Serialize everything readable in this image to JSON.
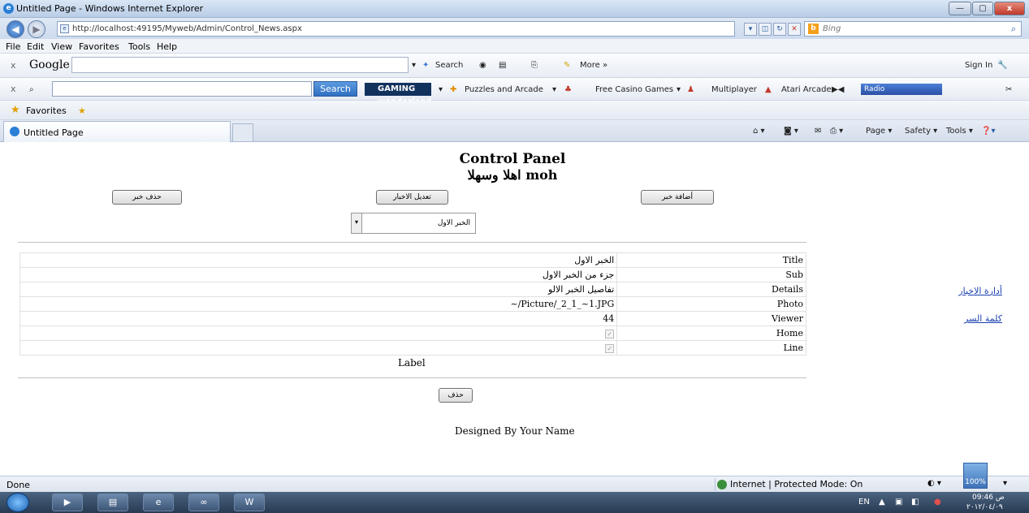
{
  "window": {
    "title": "Untitled Page - Windows Internet Explorer",
    "min_label": "—",
    "max_label": "▢",
    "close_label": "x"
  },
  "address": {
    "url": "http://localhost:49195/Myweb/Admin/Control_News.aspx",
    "search_placeholder": "Bing"
  },
  "menu": [
    "File",
    "Edit",
    "View",
    "Favorites",
    "Tools",
    "Help"
  ],
  "google_toolbar": {
    "close": "x",
    "logo": "Google",
    "search_label": "Search",
    "more_label": "More »",
    "signin_label": "Sign In"
  },
  "toolbar2": {
    "close": "x",
    "search_button": "Search",
    "gaming": "GAMING wonderland",
    "puzzles": "Puzzles and Arcade",
    "casino": "Free Casino Games",
    "multiplayer": "Multiplayer",
    "atari": "Atari Arcade",
    "radio": "Radio"
  },
  "favorites": {
    "label": "Favorites"
  },
  "tabs": {
    "active": "Untitled Page",
    "commands": [
      "Page ▾",
      "Safety ▾",
      "Tools ▾"
    ]
  },
  "page": {
    "title": "Control Panel",
    "welcome": "اهلا وسهلا moh",
    "buttons": {
      "delete_news": "حذف خبر",
      "edit_news": "تعديل الاخبار",
      "add_news": "أضافة خبر",
      "delete": "حذف"
    },
    "dropdown_value": "الخبر الاول",
    "details": [
      {
        "key": "Title",
        "value": "الخبر الاول"
      },
      {
        "key": "Sub",
        "value": "جزء من الخبر الاول"
      },
      {
        "key": "Details",
        "value": "تفاصيل الخبر الالو"
      },
      {
        "key": "Photo",
        "value": "~/Picture/_2_1_~1.JPG"
      },
      {
        "key": "Viewer",
        "value": "44"
      },
      {
        "key": "Home",
        "value": ""
      },
      {
        "key": "Line",
        "value": ""
      }
    ],
    "label": "Label",
    "footer": "Designed By Your Name",
    "side_links": [
      "أدارة الاخبار",
      "كلمة السر"
    ]
  },
  "status": {
    "left": "Done",
    "zone": "Internet | Protected Mode: On",
    "zoom": "100%"
  },
  "taskbar": {
    "lang": "EN",
    "time": "09:46 ص",
    "date": "٢٠١٢/٠٤/٠٩"
  }
}
